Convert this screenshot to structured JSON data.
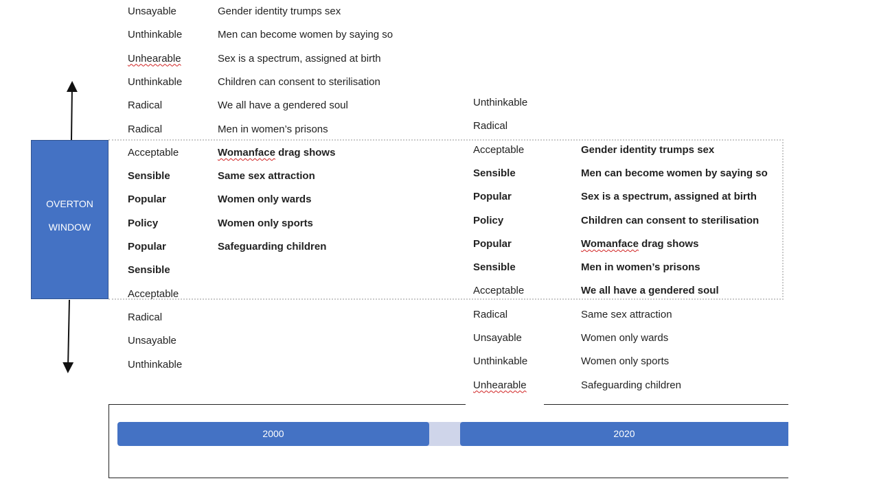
{
  "window": {
    "line1": "OVERTON",
    "line2": "WINDOW"
  },
  "col_2000": {
    "rows": [
      {
        "label": "Unsayable",
        "text": "Gender identity trumps sex",
        "bold": false,
        "label_spell": false,
        "text_spell_word": ""
      },
      {
        "label": "Unthinkable",
        "text": "Men can become women by saying so",
        "bold": false,
        "label_spell": false,
        "text_spell_word": ""
      },
      {
        "label": "Unhearable",
        "text": "Sex is a spectrum, assigned at birth",
        "bold": false,
        "label_spell": true,
        "text_spell_word": ""
      },
      {
        "label": "Unthinkable",
        "text": "Children can consent to sterilisation",
        "bold": false,
        "label_spell": false,
        "text_spell_word": ""
      },
      {
        "label": "Radical",
        "text": "We all have a gendered soul",
        "bold": false,
        "label_spell": false,
        "text_spell_word": ""
      },
      {
        "label": "Radical",
        "text": "Men in women’s prisons",
        "bold": false,
        "label_spell": false,
        "text_spell_word": ""
      },
      {
        "label": "Acceptable",
        "text": "Womanface drag shows",
        "bold": true,
        "label_bold": false,
        "label_spell": false,
        "text_spell_word": "Womanface"
      },
      {
        "label": "Sensible",
        "text": "Same sex attraction",
        "bold": true,
        "label_spell": false,
        "text_spell_word": ""
      },
      {
        "label": "Popular",
        "text": "Women only wards",
        "bold": true,
        "label_spell": false,
        "text_spell_word": ""
      },
      {
        "label": "Policy",
        "text": "Women only sports",
        "bold": true,
        "label_spell": false,
        "text_spell_word": ""
      },
      {
        "label": "Popular",
        "text": "Safeguarding children",
        "bold": true,
        "label_spell": false,
        "text_spell_word": ""
      },
      {
        "label": "Sensible",
        "text": "",
        "bold": true,
        "label_spell": false,
        "text_spell_word": ""
      },
      {
        "label": "Acceptable",
        "text": "",
        "bold": false,
        "label_spell": false,
        "text_spell_word": ""
      },
      {
        "label": "Radical",
        "text": "",
        "bold": false,
        "label_spell": false,
        "text_spell_word": ""
      },
      {
        "label": "Unsayable",
        "text": "",
        "bold": false,
        "label_spell": false,
        "text_spell_word": ""
      },
      {
        "label": "Unthinkable",
        "text": "",
        "bold": false,
        "label_spell": false,
        "text_spell_word": ""
      }
    ]
  },
  "col_2020": {
    "rows": [
      {
        "label": "Unthinkable",
        "text": "",
        "bold": false,
        "label_spell": false,
        "text_spell_word": ""
      },
      {
        "label": "Radical",
        "text": "",
        "bold": false,
        "label_spell": false,
        "text_spell_word": ""
      },
      {
        "label": "Acceptable",
        "text": "Gender identity trumps sex",
        "bold": true,
        "label_bold": false,
        "label_spell": false,
        "text_spell_word": ""
      },
      {
        "label": "Sensible",
        "text": "Men can become women by saying so",
        "bold": true,
        "label_spell": false,
        "text_spell_word": ""
      },
      {
        "label": "Popular",
        "text": "Sex is a spectrum, assigned at birth",
        "bold": true,
        "label_spell": false,
        "text_spell_word": ""
      },
      {
        "label": "Policy",
        "text": "Children can consent to sterilisation",
        "bold": true,
        "label_spell": false,
        "text_spell_word": ""
      },
      {
        "label": "Popular",
        "text": "Womanface drag shows",
        "bold": true,
        "label_spell": false,
        "text_spell_word": "Womanface"
      },
      {
        "label": "Sensible",
        "text": "Men in women’s prisons",
        "bold": true,
        "label_spell": false,
        "text_spell_word": ""
      },
      {
        "label": "Acceptable",
        "text": "We all have a gendered soul",
        "bold": true,
        "label_bold": false,
        "label_spell": false,
        "text_spell_word": ""
      },
      {
        "label": "Radical",
        "text": "Same sex attraction",
        "bold": false,
        "label_spell": false,
        "text_spell_word": ""
      },
      {
        "label": "Unsayable",
        "text": "Women only wards",
        "bold": false,
        "label_spell": false,
        "text_spell_word": ""
      },
      {
        "label": "Unthinkable",
        "text": "Women only sports",
        "bold": false,
        "label_spell": false,
        "text_spell_word": ""
      },
      {
        "label": "Unhearable",
        "text": "Safeguarding children",
        "bold": false,
        "label_spell": true,
        "text_spell_word": ""
      }
    ]
  },
  "timeline": {
    "left": "2000",
    "right": "2020"
  },
  "colors": {
    "accent": "#4472c4",
    "link": "#cfd5ea",
    "spellcheck": "#d02020"
  }
}
